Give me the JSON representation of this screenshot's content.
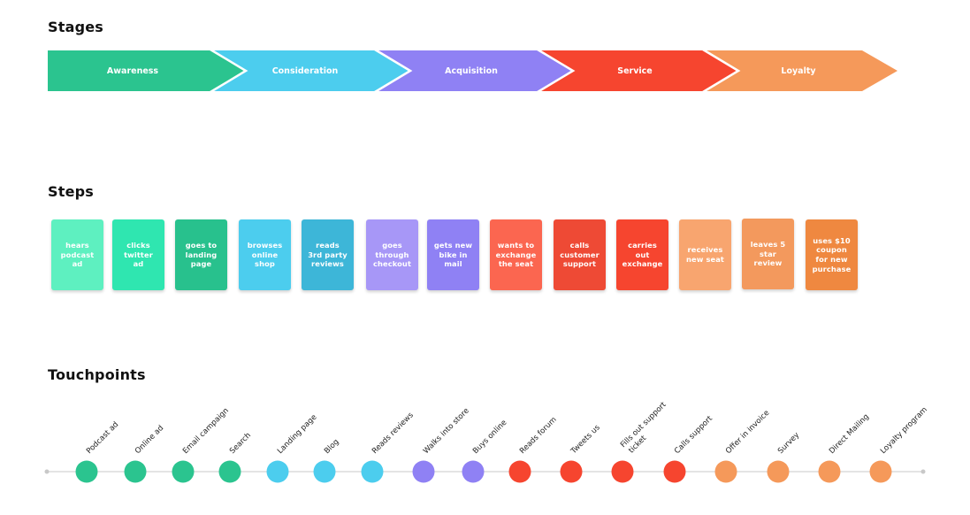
{
  "sections": {
    "stages_title": "Stages",
    "steps_title": "Steps",
    "touchpoints_title": "Touchpoints"
  },
  "stages": [
    {
      "label": "Awareness",
      "color": "#2bc48f"
    },
    {
      "label": "Consideration",
      "color": "#4ccdee"
    },
    {
      "label": "Acquisition",
      "color": "#8f81f4"
    },
    {
      "label": "Service",
      "color": "#f6452f"
    },
    {
      "label": "Loyalty",
      "color": "#f5995a"
    }
  ],
  "steps": [
    {
      "label": "hears podcast ad",
      "lines": [
        "hears",
        "podcast",
        "ad"
      ],
      "color": "#5ef0c0"
    },
    {
      "label": "clicks twitter ad",
      "lines": [
        "clicks",
        "twitter",
        "ad"
      ],
      "color": "#2fe6b0"
    },
    {
      "label": "goes to landing page",
      "lines": [
        "goes to",
        "landing",
        "page"
      ],
      "color": "#28c18d"
    },
    {
      "label": "browses online shop",
      "lines": [
        "browses",
        "online",
        "shop"
      ],
      "color": "#4ccdee"
    },
    {
      "label": "reads 3rd party reviews",
      "lines": [
        "reads",
        "3rd party",
        "reviews"
      ],
      "color": "#3db6d8"
    },
    {
      "label": "goes through checkout",
      "lines": [
        "goes",
        "through",
        "checkout"
      ],
      "color": "#a797f7"
    },
    {
      "label": "gets new bike in mail",
      "lines": [
        "gets new",
        "bike in",
        "mail"
      ],
      "color": "#8f81f4"
    },
    {
      "label": "wants to exchange the seat",
      "lines": [
        "wants to",
        "exchange",
        "the seat"
      ],
      "color": "#fb6650"
    },
    {
      "label": "calls customer support",
      "lines": [
        "calls",
        "customer",
        "support"
      ],
      "color": "#ee4a35"
    },
    {
      "label": "carries out exchange",
      "lines": [
        "carries",
        "out",
        "exchange"
      ],
      "color": "#f6452f"
    },
    {
      "label": "receives new seat",
      "lines": [
        "receives",
        "new seat"
      ],
      "color": "#f8a56f"
    },
    {
      "label": "leaves 5 star review",
      "lines": [
        "leaves 5",
        "star",
        "review"
      ],
      "color": "#f3995d"
    },
    {
      "label": "uses $10 coupon for new purchase",
      "lines": [
        "uses $10",
        "coupon",
        "for new",
        "purchase"
      ],
      "color": "#ef8840"
    }
  ],
  "touchpoints": [
    {
      "label": "Podcast ad",
      "lines": [
        "Podcast ad"
      ],
      "color": "#2bc48f"
    },
    {
      "label": "Online ad",
      "lines": [
        "Online ad"
      ],
      "color": "#2bc48f"
    },
    {
      "label": "Email campaign",
      "lines": [
        "Email campaign"
      ],
      "color": "#2bc48f"
    },
    {
      "label": "Search",
      "lines": [
        "Search"
      ],
      "color": "#2bc48f"
    },
    {
      "label": "Landing page",
      "lines": [
        "Landing page"
      ],
      "color": "#4ccdee"
    },
    {
      "label": "Blog",
      "lines": [
        "Blog"
      ],
      "color": "#4ccdee"
    },
    {
      "label": "Reads reviews",
      "lines": [
        "Reads reviews"
      ],
      "color": "#4ccdee"
    },
    {
      "label": "Walks into store",
      "lines": [
        "Walks into store"
      ],
      "color": "#8f81f4"
    },
    {
      "label": "Buys online",
      "lines": [
        "Buys online"
      ],
      "color": "#8f81f4"
    },
    {
      "label": "Reads forum",
      "lines": [
        "Reads forum"
      ],
      "color": "#f6452f"
    },
    {
      "label": "Tweets us",
      "lines": [
        "Tweets us"
      ],
      "color": "#f6452f"
    },
    {
      "label": "Fills out support ticket",
      "lines": [
        "Fills out support",
        "ticket"
      ],
      "color": "#f6452f"
    },
    {
      "label": "Calls support",
      "lines": [
        "Calls support"
      ],
      "color": "#f6452f"
    },
    {
      "label": "Offer in invoice",
      "lines": [
        "Offer in invoice"
      ],
      "color": "#f5995a"
    },
    {
      "label": "Survey",
      "lines": [
        "Survey"
      ],
      "color": "#f5995a"
    },
    {
      "label": "Direct Mailing",
      "lines": [
        "Direct Mailing"
      ],
      "color": "#f5995a"
    },
    {
      "label": "Loyalty program",
      "lines": [
        "Loyalty program"
      ],
      "color": "#f5995a"
    }
  ],
  "timeline_color": "#dcdcdc"
}
